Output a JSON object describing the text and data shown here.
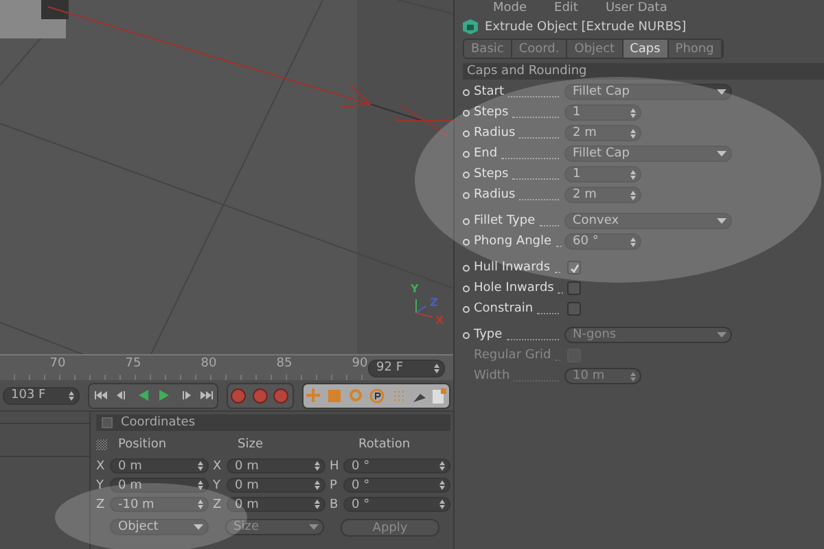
{
  "viewport": {
    "axis_labels": [
      "Y",
      "Z",
      "X"
    ]
  },
  "timeline": {
    "ticks": [
      "70",
      "75",
      "80",
      "85",
      "90"
    ],
    "end_frame": "92 F",
    "current_frame": "103 F"
  },
  "coordinates": {
    "title": "Coordinates",
    "columns": [
      "Position",
      "Size",
      "Rotation"
    ],
    "rows": [
      [
        {
          "axis": "X",
          "value": "0 m"
        },
        {
          "axis": "X",
          "value": "0 m"
        },
        {
          "axis": "H",
          "value": "0 °"
        }
      ],
      [
        {
          "axis": "Y",
          "value": "0 m"
        },
        {
          "axis": "Y",
          "value": "0 m"
        },
        {
          "axis": "P",
          "value": "0 °"
        }
      ],
      [
        {
          "axis": "Z",
          "value": "-10 m"
        },
        {
          "axis": "Z",
          "value": "0 m"
        },
        {
          "axis": "B",
          "value": "0 °"
        }
      ]
    ],
    "mode_select": {
      "value": "Object",
      "disabled": false
    },
    "size_select": {
      "value": "Size",
      "disabled": true
    },
    "apply_button": {
      "label": "Apply",
      "disabled": true
    }
  },
  "attributes": {
    "menu": [
      "Mode",
      "Edit",
      "User Data"
    ],
    "title": "Extrude Object [Extrude NURBS]",
    "tabs": [
      {
        "label": "Basic",
        "selected": false
      },
      {
        "label": "Coord.",
        "selected": false
      },
      {
        "label": "Object",
        "selected": false
      },
      {
        "label": "Caps",
        "selected": true
      },
      {
        "label": "Phong",
        "selected": false
      }
    ],
    "section": "Caps and Rounding",
    "groups": [
      [
        {
          "kind": "select",
          "label": "Start",
          "value": "Fillet Cap",
          "disabled": false,
          "value_disabled": false
        },
        {
          "kind": "number",
          "label": "Steps",
          "value": "1",
          "disabled": false,
          "value_disabled": false
        },
        {
          "kind": "number",
          "label": "Radius",
          "value": "2 m",
          "disabled": false,
          "value_disabled": false
        },
        {
          "kind": "select",
          "label": "End",
          "value": "Fillet Cap",
          "disabled": false,
          "value_disabled": false
        },
        {
          "kind": "number",
          "label": "Steps",
          "value": "1",
          "disabled": false,
          "value_disabled": false
        },
        {
          "kind": "number",
          "label": "Radius",
          "value": "2 m",
          "disabled": false,
          "value_disabled": false
        }
      ],
      [
        {
          "kind": "select",
          "label": "Fillet Type",
          "value": "Convex",
          "disabled": false,
          "value_disabled": false
        },
        {
          "kind": "number",
          "label": "Phong Angle",
          "value": "60 °",
          "disabled": false,
          "value_disabled": false
        }
      ],
      [
        {
          "kind": "checkbox",
          "label": "Hull Inwards",
          "checked": true,
          "disabled": false
        },
        {
          "kind": "checkbox",
          "label": "Hole Inwards",
          "checked": false,
          "disabled": false
        },
        {
          "kind": "checkbox",
          "label": "Constrain",
          "checked": false,
          "disabled": false
        }
      ],
      [
        {
          "kind": "select",
          "label": "Type",
          "value": "N-gons",
          "disabled": false,
          "value_disabled": true
        },
        {
          "kind": "checkbox",
          "label": "Regular Grid",
          "checked": false,
          "disabled": true
        },
        {
          "kind": "number",
          "label": "Width",
          "value": "10 m",
          "disabled": true,
          "value_disabled": true
        }
      ]
    ]
  }
}
